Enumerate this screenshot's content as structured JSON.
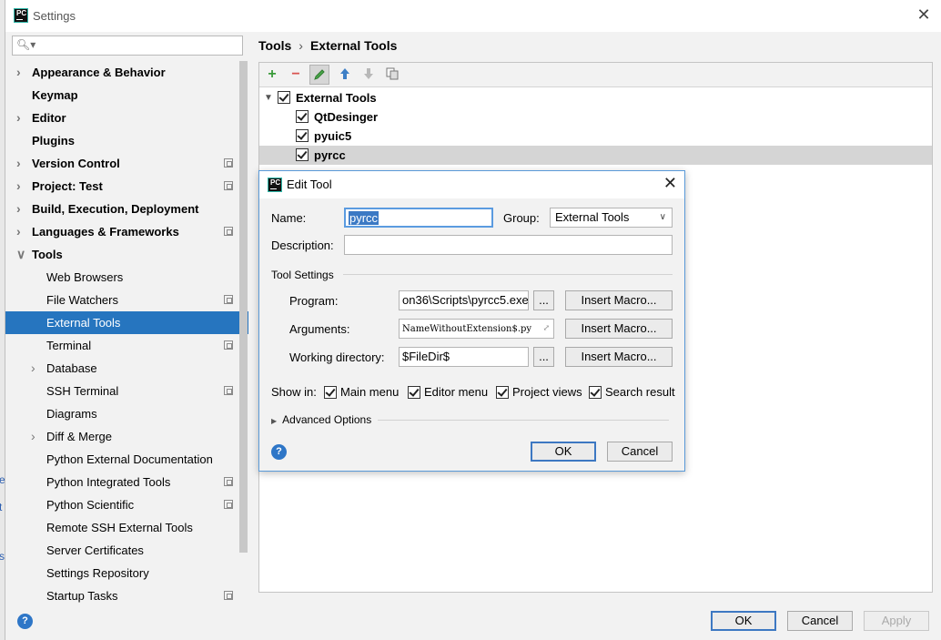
{
  "window": {
    "title": "Settings"
  },
  "search": {
    "placeholder": "",
    "icon": "search-icon"
  },
  "sidebar": {
    "items": [
      {
        "label": "Appearance & Behavior",
        "bold": true,
        "arrow": true,
        "proj": false,
        "indent": 0
      },
      {
        "label": "Keymap",
        "bold": true,
        "arrow": false,
        "proj": false,
        "indent": 0
      },
      {
        "label": "Editor",
        "bold": true,
        "arrow": true,
        "proj": false,
        "indent": 0
      },
      {
        "label": "Plugins",
        "bold": true,
        "arrow": false,
        "proj": false,
        "indent": 0
      },
      {
        "label": "Version Control",
        "bold": true,
        "arrow": true,
        "proj": true,
        "indent": 0
      },
      {
        "label": "Project: Test",
        "bold": true,
        "arrow": true,
        "proj": true,
        "indent": 0
      },
      {
        "label": "Build, Execution, Deployment",
        "bold": true,
        "arrow": true,
        "proj": false,
        "indent": 0
      },
      {
        "label": "Languages & Frameworks",
        "bold": true,
        "arrow": true,
        "proj": true,
        "indent": 0
      },
      {
        "label": "Tools",
        "bold": true,
        "arrow": "down",
        "proj": false,
        "indent": 0
      },
      {
        "label": "Web Browsers",
        "bold": false,
        "arrow": false,
        "proj": false,
        "indent": 1
      },
      {
        "label": "File Watchers",
        "bold": false,
        "arrow": false,
        "proj": true,
        "indent": 1
      },
      {
        "label": "External Tools",
        "bold": false,
        "arrow": false,
        "proj": false,
        "indent": 1,
        "selected": true
      },
      {
        "label": "Terminal",
        "bold": false,
        "arrow": false,
        "proj": true,
        "indent": 1
      },
      {
        "label": "Database",
        "bold": false,
        "arrow": true,
        "proj": false,
        "indent": 1
      },
      {
        "label": "SSH Terminal",
        "bold": false,
        "arrow": false,
        "proj": true,
        "indent": 1
      },
      {
        "label": "Diagrams",
        "bold": false,
        "arrow": false,
        "proj": false,
        "indent": 1
      },
      {
        "label": "Diff & Merge",
        "bold": false,
        "arrow": true,
        "proj": false,
        "indent": 1
      },
      {
        "label": "Python External Documentation",
        "bold": false,
        "arrow": false,
        "proj": false,
        "indent": 1
      },
      {
        "label": "Python Integrated Tools",
        "bold": false,
        "arrow": false,
        "proj": true,
        "indent": 1
      },
      {
        "label": "Python Scientific",
        "bold": false,
        "arrow": false,
        "proj": true,
        "indent": 1
      },
      {
        "label": "Remote SSH External Tools",
        "bold": false,
        "arrow": false,
        "proj": false,
        "indent": 1
      },
      {
        "label": "Server Certificates",
        "bold": false,
        "arrow": false,
        "proj": false,
        "indent": 1
      },
      {
        "label": "Settings Repository",
        "bold": false,
        "arrow": false,
        "proj": false,
        "indent": 1
      },
      {
        "label": "Startup Tasks",
        "bold": false,
        "arrow": false,
        "proj": true,
        "indent": 1
      }
    ]
  },
  "breadcrumb": {
    "parent": "Tools",
    "separator": "›",
    "current": "External Tools"
  },
  "toolbar": {
    "add": "+",
    "remove": "−"
  },
  "tool_tree": {
    "group": "External Tools",
    "items": [
      "QtDesinger",
      "pyuic5",
      "pyrcc"
    ]
  },
  "edit_tool": {
    "title": "Edit Tool",
    "name_label": "Name:",
    "name_value": "pyrcc",
    "group_label": "Group:",
    "group_value": "External Tools",
    "description_label": "Description:",
    "description_value": "",
    "tool_settings_label": "Tool Settings",
    "program_label": "Program:",
    "program_value": "on36\\Scripts\\pyrcc5.exe",
    "arguments_label": "Arguments:",
    "arguments_value": "NameWithoutExtension$.py",
    "working_dir_label": "Working directory:",
    "working_dir_value": "$FileDir$",
    "browse_label": "...",
    "insert_macro_label": "Insert Macro...",
    "show_in_label": "Show in:",
    "show_in": [
      "Main menu",
      "Editor menu",
      "Project views",
      "Search result"
    ],
    "advanced_label": "Advanced Options",
    "ok_label": "OK",
    "cancel_label": "Cancel",
    "help": "?"
  },
  "footer": {
    "ok_label": "OK",
    "cancel_label": "Cancel",
    "apply_label": "Apply",
    "help": "?"
  },
  "colors": {
    "selection": "#2675bf",
    "accent": "#3d78c2",
    "add": "#3a9a3a",
    "remove": "#d9534f"
  }
}
